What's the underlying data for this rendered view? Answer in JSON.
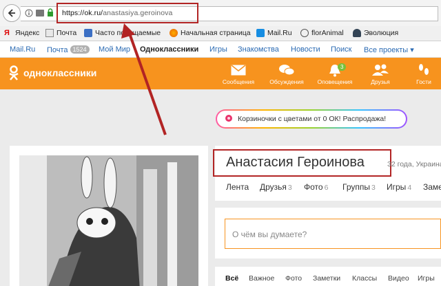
{
  "browser": {
    "url_domain": "https://ok.ru/",
    "url_path": "anastasiya.geroinova",
    "bookmarks": [
      "Яндекс",
      "Почта",
      "Часто посещаемые",
      "Начальная страница",
      "Mail.Ru",
      "florAnimal",
      "Эволюция"
    ]
  },
  "mailru_bar": {
    "links": [
      "Mail.Ru",
      "Почта",
      "Мой Мир",
      "Одноклассники",
      "Игры",
      "Знакомства",
      "Новости",
      "Поиск",
      "Все проекты ▾"
    ],
    "mail_count": "1524"
  },
  "ok_header": {
    "logo": "одноклассники",
    "nav": [
      "Сообщения",
      "Обсуждения",
      "Оповещения",
      "Друзья",
      "Гости"
    ],
    "notifications_badge": "3"
  },
  "promo": {
    "text": "Корзиночки с цветами от 0 ОК! Распродажа!"
  },
  "profile": {
    "name": "Анастасия Героинова",
    "age_city": "32 года, Украина",
    "tabs": [
      {
        "label": "Лента",
        "count": ""
      },
      {
        "label": "Друзья",
        "count": "3"
      },
      {
        "label": "Фото",
        "count": "6"
      },
      {
        "label": "Группы",
        "count": "3"
      },
      {
        "label": "Игры",
        "count": "4"
      },
      {
        "label": "Замет",
        "count": ""
      }
    ]
  },
  "post": {
    "placeholder": "О чём вы думаете?"
  },
  "feed_tabs": [
    "Всё",
    "Важное",
    "Фото",
    "Заметки",
    "Классы",
    "Видео",
    "Игры"
  ],
  "colors": {
    "ok_orange": "#f7931e",
    "highlight_red": "#b22424",
    "link_blue": "#2a6ab3"
  }
}
